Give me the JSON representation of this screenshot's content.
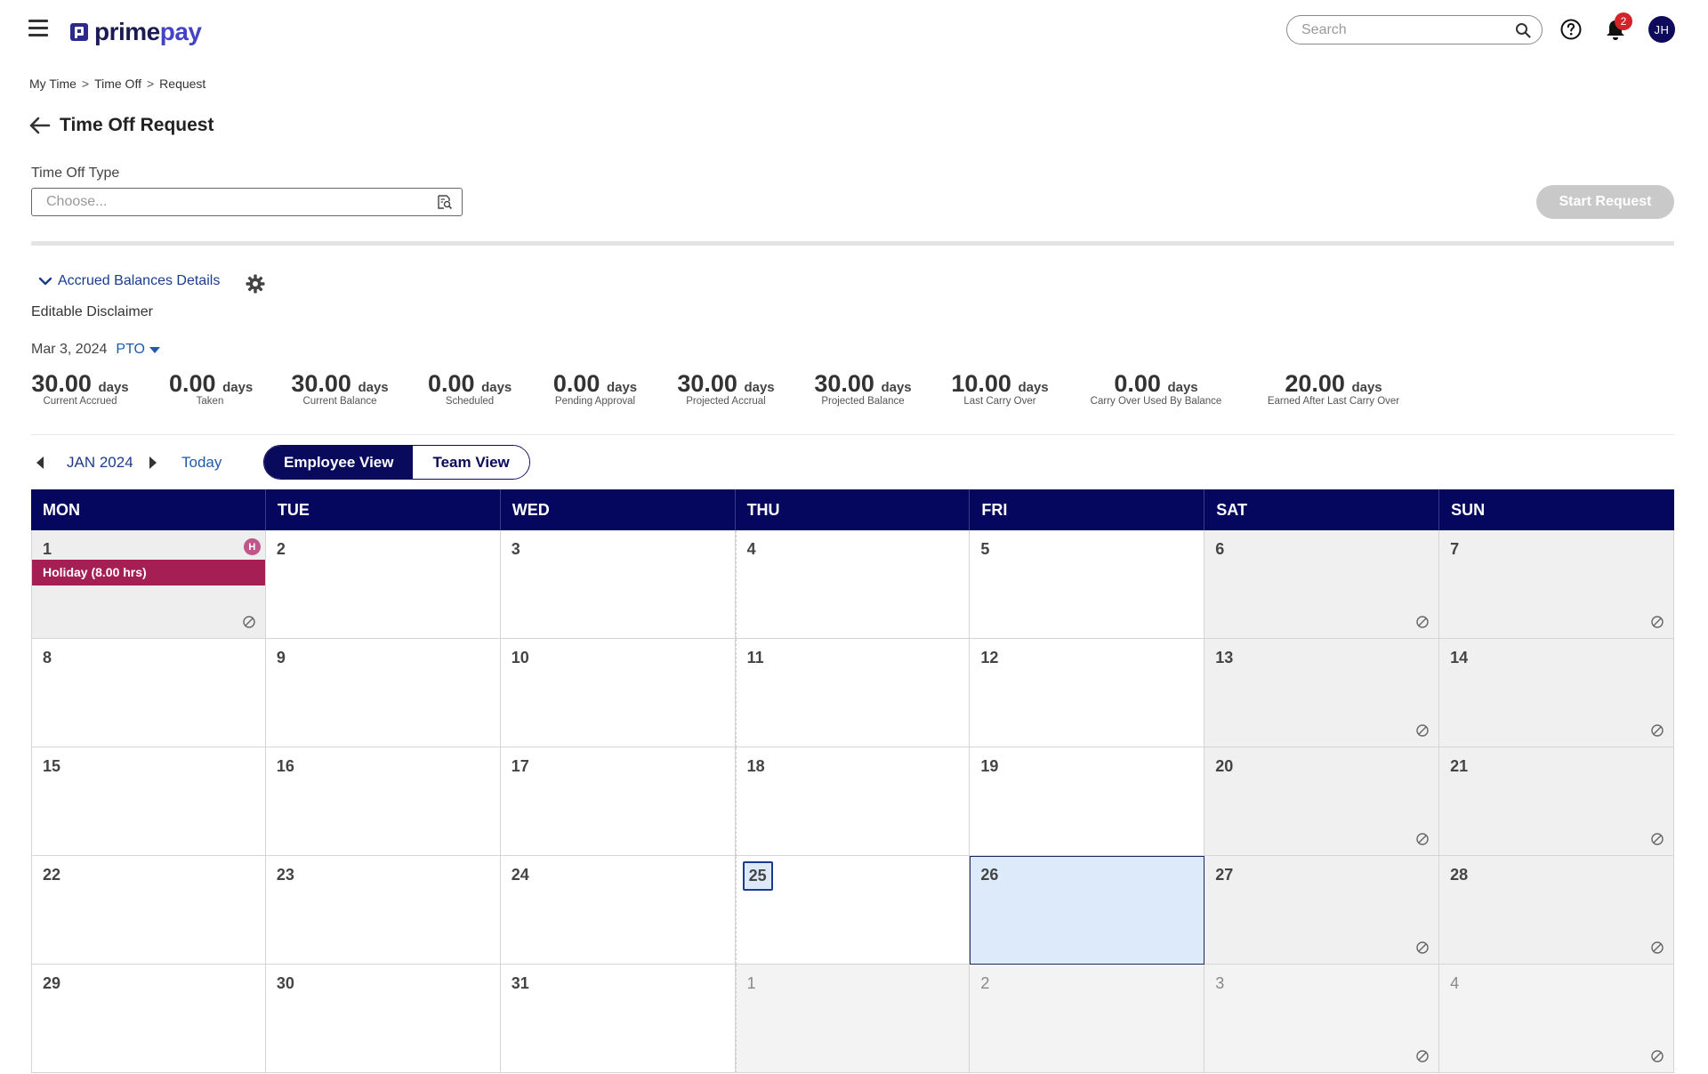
{
  "header": {
    "logo_prime": "prime",
    "logo_pay": "pay",
    "search_placeholder": "Search",
    "notifications_count": "2",
    "avatar_initials": "JH"
  },
  "breadcrumb": {
    "items": [
      "My Time",
      "Time Off",
      "Request"
    ],
    "separator": ">"
  },
  "page": {
    "title": "Time Off Request",
    "type_label": "Time Off Type",
    "type_placeholder": "Choose...",
    "start_button": "Start Request"
  },
  "balances": {
    "toggle_label": "Accrued Balances Details",
    "disclaimer": "Editable Disclaimer",
    "as_of_date": "Mar 3, 2024",
    "plan": "PTO",
    "unit": "days",
    "items": [
      {
        "value": "30.00",
        "caption": "Current Accrued"
      },
      {
        "value": "0.00",
        "caption": "Taken"
      },
      {
        "value": "30.00",
        "caption": "Current Balance"
      },
      {
        "value": "0.00",
        "caption": "Scheduled"
      },
      {
        "value": "0.00",
        "caption": "Pending Approval"
      },
      {
        "value": "30.00",
        "caption": "Projected Accrual"
      },
      {
        "value": "30.00",
        "caption": "Projected Balance"
      },
      {
        "value": "10.00",
        "caption": "Last Carry Over"
      },
      {
        "value": "0.00",
        "caption": "Carry Over Used By Balance"
      },
      {
        "value": "20.00",
        "caption": "Earned After Last Carry Over"
      }
    ]
  },
  "calendar": {
    "month_label": "JAN 2024",
    "today_label": "Today",
    "views": [
      "Employee View",
      "Team View"
    ],
    "active_view": "Employee View",
    "weekdays": [
      "MON",
      "TUE",
      "WED",
      "THU",
      "FRI",
      "SAT",
      "SUN"
    ],
    "holiday": {
      "day": "1",
      "label": "Holiday (8.00 hrs)",
      "marker": "H"
    },
    "today_day": "25",
    "selected_day": "26",
    "weeks": [
      [
        "1",
        "2",
        "3",
        "4",
        "5",
        "6",
        "7"
      ],
      [
        "8",
        "9",
        "10",
        "11",
        "12",
        "13",
        "14"
      ],
      [
        "15",
        "16",
        "17",
        "18",
        "19",
        "20",
        "21"
      ],
      [
        "22",
        "23",
        "24",
        "25",
        "26",
        "27",
        "28"
      ],
      [
        "29",
        "30",
        "31",
        "1",
        "2",
        "3",
        "4"
      ]
    ]
  },
  "colors": {
    "navy": "#05075e",
    "holiday": "#a51f54",
    "link": "#1f5aa8",
    "selected": "#dceaf9"
  }
}
